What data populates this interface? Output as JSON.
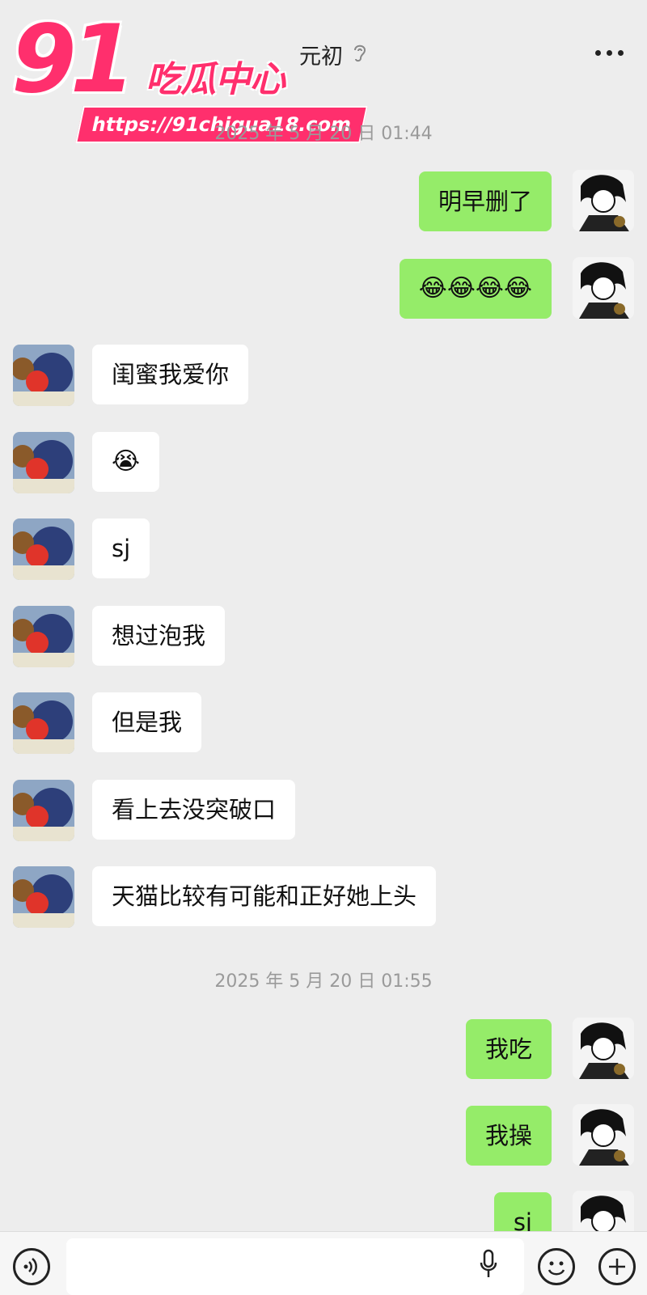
{
  "header": {
    "title": "元初",
    "ear_icon": "ear-icon",
    "more_icon": "more-dots-icon"
  },
  "watermark": {
    "number": "91",
    "brand": "吃瓜中心",
    "url": "https://91chigua18.com",
    "color": "#ff2f6d"
  },
  "timestamps": [
    "2025 年 5 月 20 日 01:44",
    "2025 年 5 月 20 日 01:55"
  ],
  "messages": [
    {
      "side": "out",
      "text": "明早删了"
    },
    {
      "side": "out",
      "text": "😂😂😂😂"
    },
    {
      "side": "in",
      "text": "闺蜜我爱你"
    },
    {
      "side": "in",
      "text": "😭"
    },
    {
      "side": "in",
      "text": "sj"
    },
    {
      "side": "in",
      "text": "想过泡我"
    },
    {
      "side": "in",
      "text": "但是我"
    },
    {
      "side": "in",
      "text": "看上去没突破口"
    },
    {
      "side": "in",
      "text": "天猫比较有可能和正好她上头"
    },
    {
      "side": "out",
      "text": "我吃"
    },
    {
      "side": "out",
      "text": "我操"
    },
    {
      "side": "out",
      "text": "sj"
    }
  ],
  "input_bar": {
    "voice_icon": "voice-icon",
    "mic_icon": "microphone-icon",
    "emoji_icon": "emoji-icon",
    "plus_icon": "plus-icon",
    "value": ""
  },
  "colors": {
    "background": "#ededed",
    "outgoing_bubble": "#95ec69",
    "incoming_bubble": "#ffffff",
    "timestamp": "#9a9a9a"
  }
}
